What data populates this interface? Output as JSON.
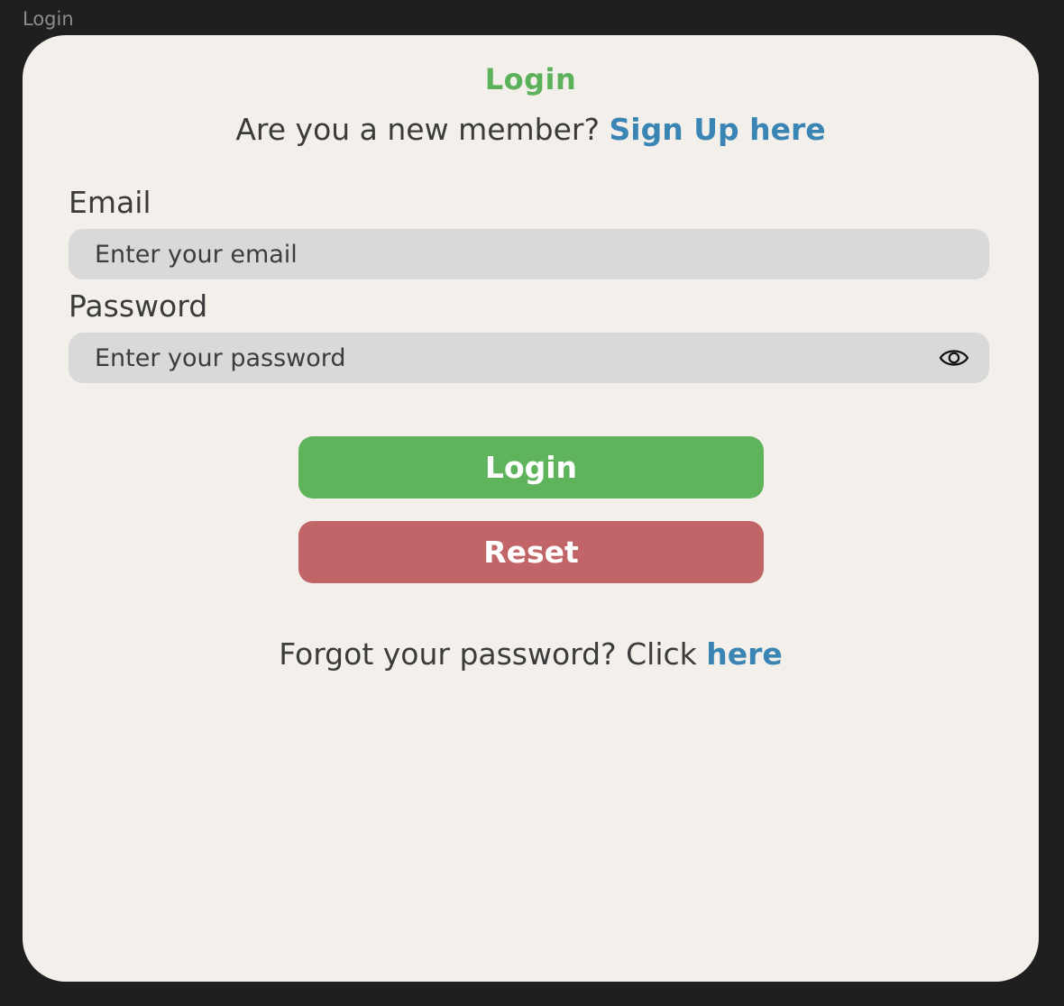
{
  "window": {
    "frame_label": "Login"
  },
  "login_form": {
    "title": "Login",
    "signup_prompt": "Are you a new member? ",
    "signup_link": "Sign Up here",
    "email": {
      "label": "Email",
      "placeholder": "Enter your email",
      "value": ""
    },
    "password": {
      "label": "Password",
      "placeholder": "Enter your password",
      "value": "",
      "toggle_icon": "eye-icon"
    },
    "login_button": "Login",
    "reset_button": "Reset",
    "forgot_prompt": "Forgot your password? Click ",
    "forgot_link": "here"
  },
  "colors": {
    "background": "#1f1f1f",
    "card": "#f3f0ec",
    "title_green": "#5bb25a",
    "link_blue": "#3a85b4",
    "login_button": "#5fb45b",
    "reset_button": "#c26568",
    "input_bg": "#d9d9d9"
  }
}
